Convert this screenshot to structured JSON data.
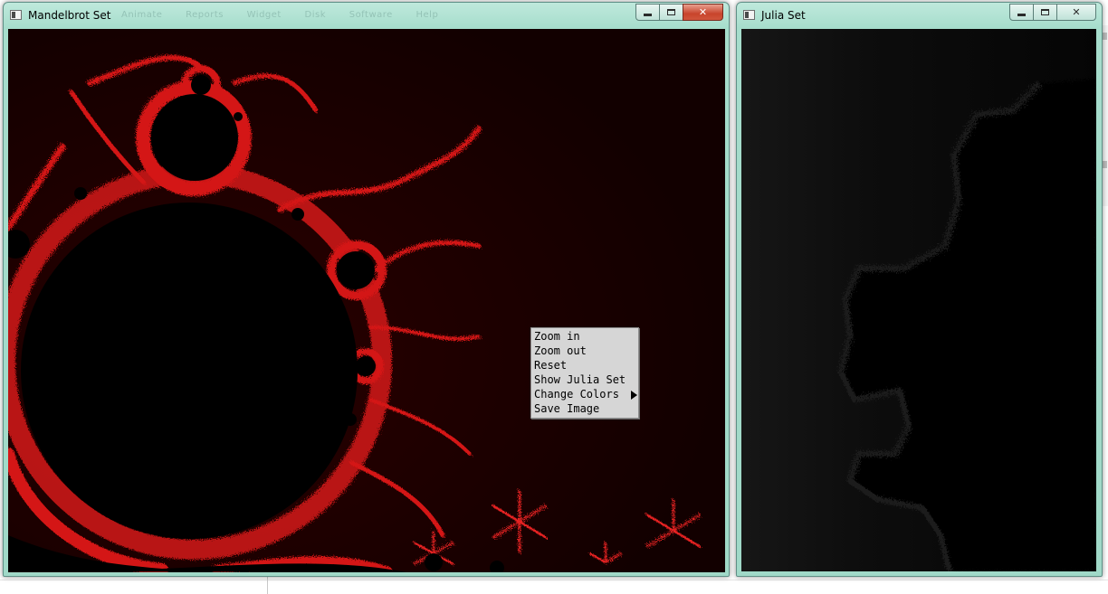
{
  "mandelbrot_window": {
    "title": "Mandelbrot Set",
    "ghost_menu": [
      "Animate",
      "Reports",
      "Widget",
      "Disk",
      "Software",
      "Help"
    ]
  },
  "julia_window": {
    "title": "Julia Set"
  },
  "context_menu": {
    "items": [
      {
        "label": "Zoom in"
      },
      {
        "label": "Zoom out"
      },
      {
        "label": "Reset"
      },
      {
        "label": "Show Julia Set"
      },
      {
        "label": "Change Colors"
      },
      {
        "label": "Save Image"
      }
    ]
  },
  "colors": {
    "mandel_background": "#140000",
    "mandel_set": "#000000",
    "mandel_edge": "#e01818",
    "julia_background": "#000000",
    "julia_edge": "#2a2a2a",
    "window_frame": "#a6ddcc",
    "close_button": "#c8442b"
  },
  "icons": {
    "window_icon": "app-window-icon",
    "minimize": "minimize-icon",
    "maximize": "maximize-icon",
    "close": "close-icon",
    "submenu": "submenu-arrow-icon"
  }
}
